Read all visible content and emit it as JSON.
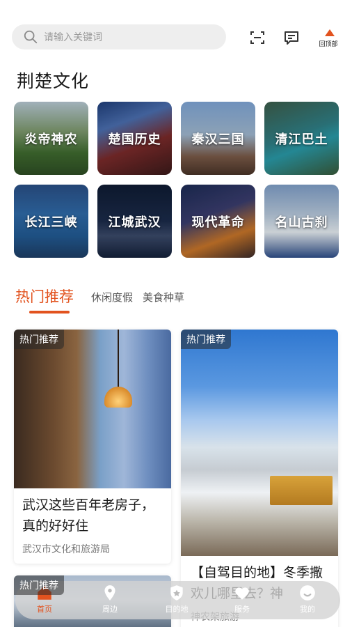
{
  "search": {
    "placeholder": "请输入关键词"
  },
  "header": {
    "back_to_top_label": "回顶部"
  },
  "section": {
    "title": "荆楚文化"
  },
  "culture_tiles": [
    {
      "label": "炎帝神农"
    },
    {
      "label": "楚国历史"
    },
    {
      "label": "秦汉三国"
    },
    {
      "label": "清江巴土"
    },
    {
      "label": "长江三峡"
    },
    {
      "label": "江城武汉"
    },
    {
      "label": "现代革命"
    },
    {
      "label": "名山古刹"
    }
  ],
  "tabs": [
    {
      "label": "热门推荐",
      "active": true
    },
    {
      "label": "休闲度假",
      "active": false
    },
    {
      "label": "美食种草",
      "active": false
    }
  ],
  "cards": [
    {
      "badge": "热门推荐",
      "title": "武汉这些百年老房子，真的好好住",
      "source": "武汉市文化和旅游局"
    },
    {
      "badge": "热门推荐",
      "title": "【自驾目的地】冬季撒欢儿哪里去？神",
      "source": "神农架旅游"
    },
    {
      "badge": "热门推荐"
    }
  ],
  "bottom_nav": [
    {
      "label": "首页",
      "icon": "home-icon",
      "active": true
    },
    {
      "label": "周边",
      "icon": "location-pin-icon",
      "active": false
    },
    {
      "label": "目的地",
      "icon": "destination-shield-icon",
      "active": false
    },
    {
      "label": "服务",
      "icon": "service-heart-icon",
      "active": false
    },
    {
      "label": "我的",
      "icon": "profile-icon",
      "active": false
    }
  ],
  "colors": {
    "accent": "#e2531f",
    "search_bg": "#eeeeee"
  }
}
